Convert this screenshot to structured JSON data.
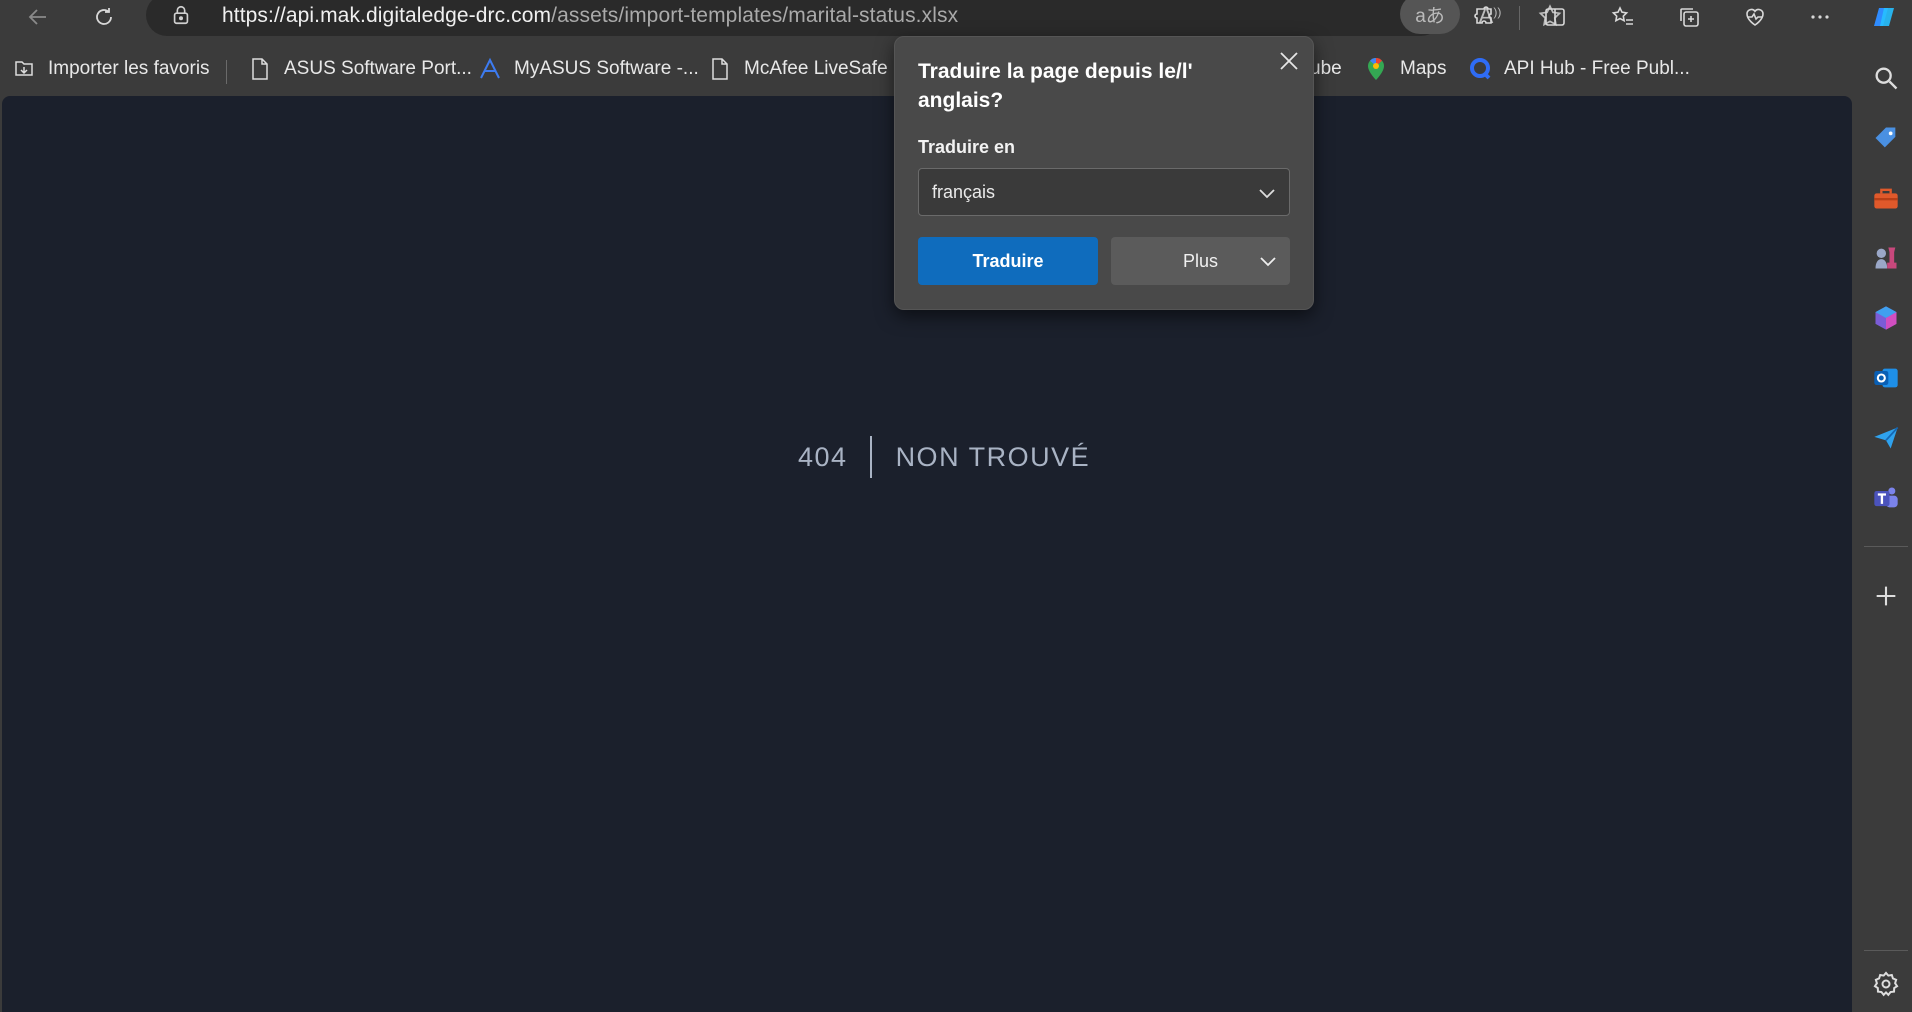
{
  "browser": {
    "url_host": "https://api.mak.digitaledge-drc.com",
    "url_path": "/assets/import-templates/marital-status.xlsx",
    "translate_indicator": "aあ",
    "read_aloud_label": "A"
  },
  "favorites": [
    {
      "label": "Importer les favoris",
      "icon": "import-favorites-icon"
    },
    {
      "label": "ASUS Software Port...",
      "icon": "page-icon"
    },
    {
      "label": "MyASUS Software -...",
      "icon": "myasus-logo-icon"
    },
    {
      "label": "McAfee LiveSafe",
      "icon": "page-icon"
    },
    {
      "label": "ube",
      "icon": "youtube-icon"
    },
    {
      "label": "Maps",
      "icon": "maps-icon"
    },
    {
      "label": "API Hub - Free Publ...",
      "icon": "api-hub-icon"
    }
  ],
  "page": {
    "status_code": "404",
    "status_message": "NON TROUVÉ"
  },
  "translate_popup": {
    "title": "Traduire la page depuis le/l' anglais?",
    "label": "Traduire en",
    "selected_language": "français",
    "translate_button": "Traduire",
    "more_button": "Plus"
  },
  "colors": {
    "page_background": "#1b202c",
    "primary_button": "#0f6cbd",
    "chrome_background": "#3b3b3b"
  }
}
